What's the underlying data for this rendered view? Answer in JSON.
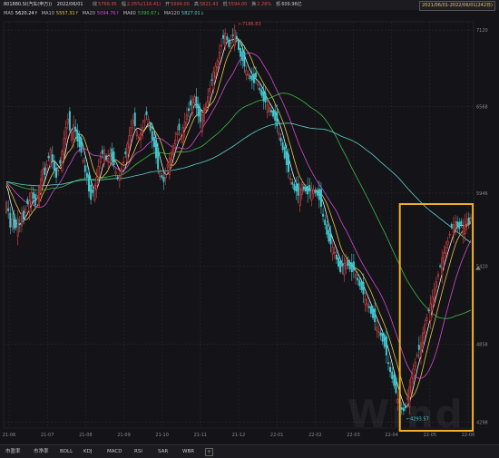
{
  "header": {
    "code": "801880.SI(汽车(申万))",
    "date": "2022/06/01",
    "fields": [
      {
        "label": "收",
        "value": "5768.95",
        "color": "#e04545"
      },
      {
        "label": "幅",
        "value": "2.05%(116.41)",
        "color": "#e04545"
      },
      {
        "label": "开",
        "value": "5694.00",
        "color": "#e04545"
      },
      {
        "label": "高",
        "value": "5821.43",
        "color": "#e04545"
      },
      {
        "label": "低",
        "value": "5594.00",
        "color": "#e04545"
      },
      {
        "label": "换",
        "value": "2.26%",
        "color": "#e04545"
      },
      {
        "label": "额",
        "value": "609.96亿",
        "color": "#c8c8c8"
      }
    ],
    "range": "2021/06/01-2022/06/01(242日)"
  },
  "ma_legend": [
    {
      "label": "MA5",
      "value": "5620.24↑",
      "color": "#f0f0f0"
    },
    {
      "label": "MA10",
      "value": "5557.31↑",
      "color": "#e8c84a"
    },
    {
      "label": "MA20",
      "value": "5094.76↑",
      "color": "#d04ad0"
    },
    {
      "label": "MA60",
      "value": "5390.67↓",
      "color": "#3fb94a"
    },
    {
      "label": "MA120",
      "value": "5827.01↓",
      "color": "#60d0c8"
    }
  ],
  "chart_data": {
    "type": "candlestick",
    "x_ticks": [
      "21-06",
      "21-07",
      "21-08",
      "21-09",
      "21-10",
      "21-11",
      "21-12",
      "22-01",
      "22-02",
      "22-03",
      "22-04",
      "22-05",
      "22-06"
    ],
    "y_ticks": [
      7120,
      6568,
      5946,
      5420,
      4858,
      4298
    ],
    "ylim": [
      4255,
      7180
    ],
    "annotations": {
      "high": "7186.83",
      "low": "4293.57"
    },
    "closes": [
      5880,
      5820,
      5700,
      5760,
      5690,
      5700,
      5760,
      5720,
      5800,
      5760,
      5830,
      5870,
      5890,
      5950,
      5910,
      5860,
      5930,
      5990,
      6050,
      6120,
      6080,
      6150,
      6200,
      6260,
      6180,
      6110,
      6060,
      6110,
      6160,
      6250,
      6340,
      6420,
      6480,
      6400,
      6380,
      6440,
      6390,
      6320,
      6280,
      6240,
      6180,
      6100,
      6060,
      5960,
      5900,
      5950,
      6000,
      6060,
      6140,
      6200,
      6230,
      6260,
      6190,
      6200,
      6230,
      6180,
      6150,
      6100,
      6050,
      6070,
      6120,
      6170,
      6230,
      6300,
      6360,
      6420,
      6470,
      6430,
      6390,
      6350,
      6380,
      6420,
      6470,
      6510,
      6480,
      6400,
      6330,
      6280,
      6200,
      6120,
      6100,
      6060,
      6030,
      6080,
      6150,
      6200,
      6240,
      6290,
      6330,
      6380,
      6400,
      6350,
      6420,
      6460,
      6510,
      6540,
      6580,
      6620,
      6640,
      6560,
      6500,
      6460,
      6510,
      6560,
      6590,
      6640,
      6700,
      6760,
      6820,
      6860,
      6900,
      6960,
      7010,
      7060,
      7100,
      7050,
      7000,
      7030,
      7080,
      7120,
      7060,
      6980,
      6930,
      6900,
      6860,
      6830,
      6800,
      6770,
      6760,
      6740,
      6780,
      6730,
      6690,
      6650,
      6610,
      6600,
      6580,
      6560,
      6530,
      6500,
      6470,
      6430,
      6380,
      6320,
      6260,
      6200,
      6150,
      6100,
      6050,
      6010,
      5970,
      5960,
      5930,
      5980,
      6010,
      5980,
      5960,
      5940,
      5960,
      5980,
      5970,
      5950,
      5930,
      5900,
      5850,
      5780,
      5720,
      5650,
      5600,
      5580,
      5560,
      5520,
      5470,
      5420,
      5380,
      5420,
      5440,
      5470,
      5430,
      5400,
      5380,
      5390,
      5360,
      5320,
      5280,
      5250,
      5220,
      5180,
      5150,
      5120,
      5080,
      5050,
      5020,
      4980,
      4950,
      4920,
      4880,
      4840,
      4780,
      4720,
      4660,
      4610,
      4560,
      4510,
      4460,
      4420,
      4390,
      4380,
      4400,
      4470,
      4550,
      4620,
      4680,
      4730,
      4780,
      4820,
      4870,
      4940,
      5000,
      5050,
      5100,
      5150,
      5200,
      5260,
      5310,
      5360,
      5420,
      5480,
      5520,
      5560,
      5600,
      5650,
      5700,
      5720,
      5740,
      5710,
      5690,
      5720,
      5700,
      5740,
      5760,
      5730,
      5768.95
    ],
    "series": [
      {
        "name": "MA5",
        "color": "#f0f0f0"
      },
      {
        "name": "MA10",
        "color": "#e8c84a"
      },
      {
        "name": "MA20",
        "color": "#d04ad0"
      },
      {
        "name": "MA60",
        "color": "#3fb94a"
      },
      {
        "name": "MA120",
        "color": "#60d0c8"
      }
    ],
    "highlight": {
      "from_index": 206,
      "to_index": 241,
      "color": "#f0b020"
    },
    "grid": true
  },
  "tabs": [
    "市盈率",
    "市净率",
    "BOLL",
    "KDJ",
    "MACD",
    "RSI",
    "SAR",
    "WBR"
  ],
  "watermark": "Wind"
}
